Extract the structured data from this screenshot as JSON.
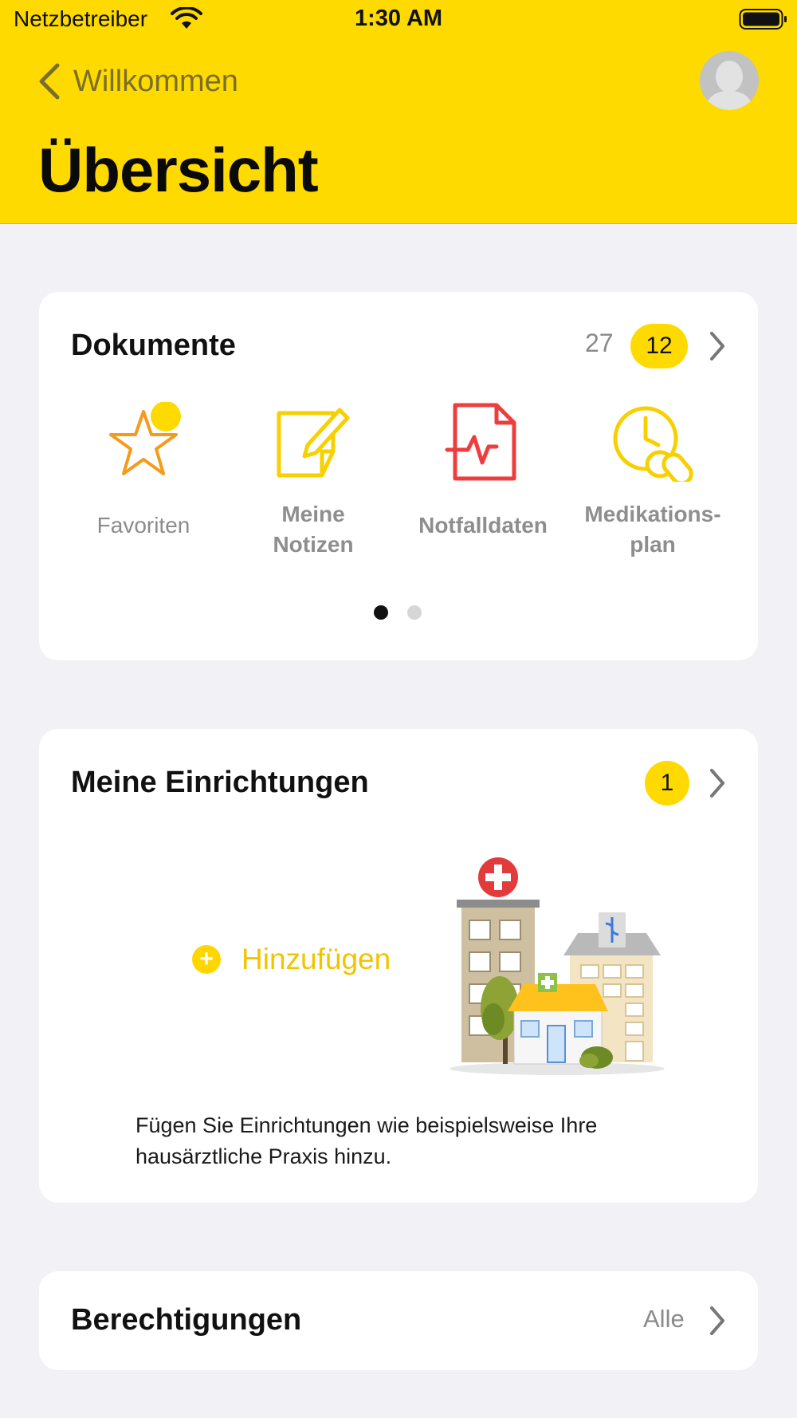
{
  "status_bar": {
    "carrier": "Netzbetreiber",
    "time": "1:30 AM"
  },
  "nav": {
    "back_label": "Willkommen",
    "title": "Übersicht"
  },
  "colors": {
    "accent": "#ffda00",
    "background": "#f1f1f6"
  },
  "documents": {
    "title": "Dokumente",
    "count": "27",
    "badge": "12",
    "items": [
      {
        "label": "Favoriten",
        "icon": "star-icon"
      },
      {
        "label": "Meine Notizen",
        "icon": "note-icon"
      },
      {
        "label": "Notfalldaten",
        "icon": "emergency-document-icon"
      },
      {
        "label": "Medikations-plan",
        "icon": "medication-clock-icon"
      }
    ],
    "pagination": {
      "pages": 2,
      "active": 1
    }
  },
  "facilities": {
    "title": "Meine Einrichtungen",
    "badge": "1",
    "add_label": "Hinzufügen",
    "description": "Fügen Sie Einrichtungen wie beispielsweise Ihre hausärztliche Praxis hinzu."
  },
  "permissions": {
    "title": "Berechtigungen",
    "value": "Alle"
  }
}
